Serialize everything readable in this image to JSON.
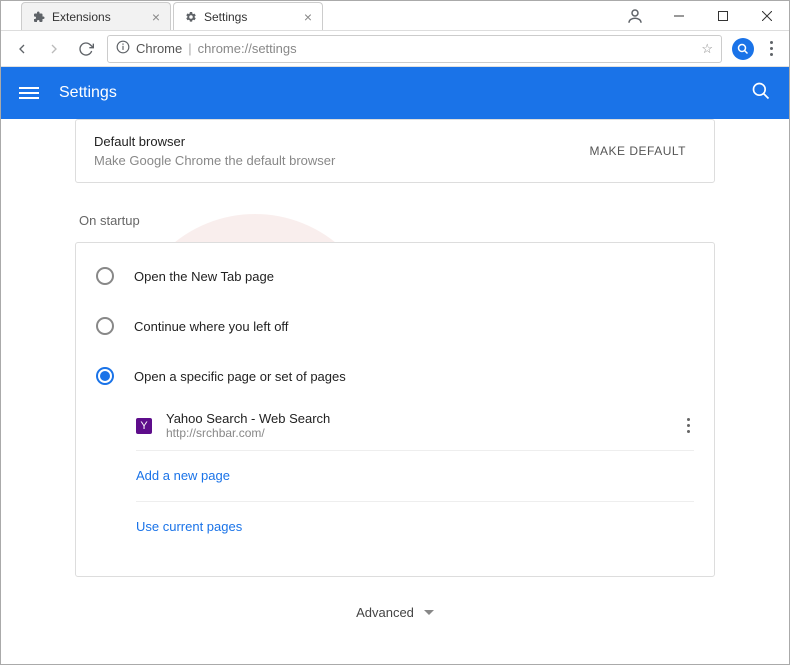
{
  "window": {
    "tabs": [
      {
        "label": "Extensions",
        "icon": "puzzle"
      },
      {
        "label": "Settings",
        "icon": "gear"
      }
    ]
  },
  "omnibox": {
    "scheme": "Chrome",
    "url": "chrome://settings"
  },
  "settings_header": {
    "title": "Settings"
  },
  "default_browser": {
    "title": "Default browser",
    "subtitle": "Make Google Chrome the default browser",
    "button": "MAKE DEFAULT"
  },
  "startup": {
    "section_label": "On startup",
    "options": [
      "Open the New Tab page",
      "Continue where you left off",
      "Open a specific page or set of pages"
    ],
    "pages": [
      {
        "title": "Yahoo Search - Web Search",
        "url": "http://srchbar.com/",
        "favicon_letter": "Y"
      }
    ],
    "add_page": "Add a new page",
    "use_current": "Use current pages"
  },
  "advanced_label": "Advanced"
}
